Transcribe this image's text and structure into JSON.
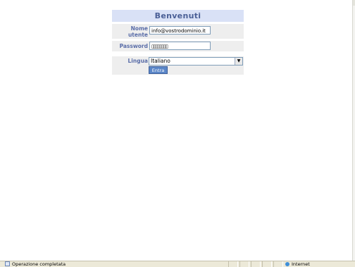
{
  "login": {
    "title": "Benvenuti",
    "username_label_line1": "Nome",
    "username_label_line2": "utente",
    "username_value": "info@vostrodominio.it",
    "password_label": "Password",
    "password_value": "▯▯▯▯▯▯▯▯",
    "language_label": "Lingua",
    "language_value": "Italiano",
    "submit_label": "Entra"
  },
  "statusbar": {
    "status_text": "Operazione completata",
    "zone_text": "Internet",
    "status_icon": "page-done-icon",
    "zone_icon": "globe-icon"
  }
}
